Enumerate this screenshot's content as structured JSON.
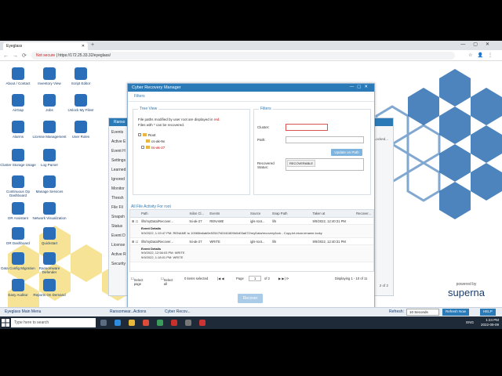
{
  "browser": {
    "tab_title": "Eyeglass",
    "omni_warning": "Not secure",
    "url": "https://172.25.33.32/eyeglass/"
  },
  "desktop_icons": [
    {
      "label": "About / Contact",
      "icon": "info-icon",
      "color": "#2a6db8"
    },
    {
      "label": "Inventory View",
      "icon": "inventory-icon",
      "color": "#2a6db8"
    },
    {
      "label": "Script Editor",
      "icon": "script-editor-icon",
      "color": "#2a6db8"
    },
    {
      "label": "AirGap",
      "icon": "airgap-icon",
      "color": "#2a6db8"
    },
    {
      "label": "Jobs",
      "icon": "jobs-icon",
      "color": "#2a6db8"
    },
    {
      "label": "Unlock My Files!",
      "icon": "unlock-icon",
      "color": "#2a6db8"
    },
    {
      "label": "Alarms",
      "icon": "alarm-icon",
      "color": "#2a6db8"
    },
    {
      "label": "License Management",
      "icon": "license-icon",
      "color": "#2a6db8"
    },
    {
      "label": "User Roles",
      "icon": "user-roles-icon",
      "color": "#2a6db8"
    },
    {
      "label": "Cluster Storage Usage",
      "icon": "storage-icon",
      "color": "#2a6db8"
    },
    {
      "label": "Log Parser",
      "icon": "log-icon",
      "color": "#2a6db8"
    },
    {
      "label": "Continuous Op Dashboard",
      "icon": "dashboard-icon",
      "color": "#2a6db8"
    },
    {
      "label": "Manage Services",
      "icon": "services-icon",
      "color": "#2a6db8"
    },
    {
      "label": "DR Assistant",
      "icon": "dr-assistant-icon",
      "color": "#2a6db8"
    },
    {
      "label": "Network Visualization",
      "icon": "network-icon",
      "color": "#2a6db8"
    },
    {
      "label": "DR Dashboard",
      "icon": "dr-dashboard-icon",
      "color": "#2a6db8"
    },
    {
      "label": "Quickstart",
      "icon": "quickstart-icon",
      "color": "#2a6db8"
    },
    {
      "label": "Data Config Migration",
      "icon": "migration-icon",
      "color": "#2a6db8"
    },
    {
      "label": "Ransomware Defender",
      "icon": "ransomware-icon",
      "color": "#2a6db8"
    },
    {
      "label": "Easy Auditor",
      "icon": "auditor-icon",
      "color": "#2a6db8"
    },
    {
      "label": "Reports On Demand",
      "icon": "reports-icon",
      "color": "#2a6db8"
    }
  ],
  "bgpanel": {
    "title": "Ranso",
    "side": [
      "Events",
      "Active E",
      "Event H",
      "Settings",
      "Learned",
      "Ignored",
      "Monitor",
      "Thresh",
      "File Fil",
      "Snapsh",
      "Status",
      "Event D",
      "License",
      "Active R",
      "Security"
    ],
    "note": "Locked...",
    "pager": "2 of 2"
  },
  "dialog": {
    "title": "Cyber Recovery Manager",
    "filters_header": "Filters",
    "tree_view_label": "Tree View",
    "tree_note_1": "File paths modified by user root are displayed in",
    "tree_note_red": "red.",
    "tree_note_2": "Files with * can be recovered.",
    "tree_root": "Root",
    "tree_child_1": "cs-ak-9x",
    "tree_child_2": "tsi-ak-27",
    "filters_label": "Filters",
    "cluster_label": "Cluster:",
    "path_label": "Path:",
    "update_button": "Update on Path",
    "recovered_status_label": "Recovered Status:",
    "recovered_chip": "RECOVERABLE",
    "activity_header": "All File Activity For root",
    "columns": [
      "Path",
      "Isilon Cl...",
      "Events",
      "Source",
      "Snap Path",
      "Taken at",
      "Recover..."
    ],
    "rows": [
      {
        "path": "/ifs/myData/Recover...",
        "cluster": "tsi-ak-27",
        "event": "RENAME",
        "source": "igls-root...",
        "snap": "/ifs",
        "taken": "9/9/2022, 12:40:31 PM",
        "details_title": "Event Details",
        "details_1": "9/9/2022, 1:19:47 PM: RENAME to 10065fa6ab5e92547f42461809b0d03a672/myData/recovery/lock - Copy.txt.eicar.rename.locky",
        "details_2": ""
      },
      {
        "path": "/ifs/myData/Recover...",
        "cluster": "tsi-ak-27",
        "event": "WRITE",
        "source": "igls-root...",
        "snap": "/ifs",
        "taken": "9/9/2022, 12:40:31 PM",
        "details_title": "Event Details",
        "details_1": "9/9/2022, 12:56:03 PM: WRITE",
        "details_2": "9/9/2022, 1:18:01 PM: WRITE"
      }
    ],
    "foot_select_page": "Select page",
    "foot_select_all": "Select all",
    "foot_selected": "0 items selected",
    "foot_page_label": "Page",
    "foot_page_value": "1",
    "foot_page_of": "of 2",
    "foot_displaying": "Displaying 1 - 10 of 11",
    "recover_button": "Recover"
  },
  "ebar": {
    "main_menu": "Eyeglass Main Menu",
    "task_1": "Ransomwar...",
    "task_2": "Actions",
    "task_3": "Cyber Recov...",
    "refresh_label": "Refresh:",
    "refresh_value": "10 Seconds",
    "refresh_now": "Refresh Now",
    "help": "HELP"
  },
  "brand": {
    "powered": "powered by",
    "name": "superna"
  },
  "taskbar": {
    "search_placeholder": "Type here to search",
    "lang": "ENG",
    "time": "1:24 PM",
    "date": "2022-09-09"
  }
}
